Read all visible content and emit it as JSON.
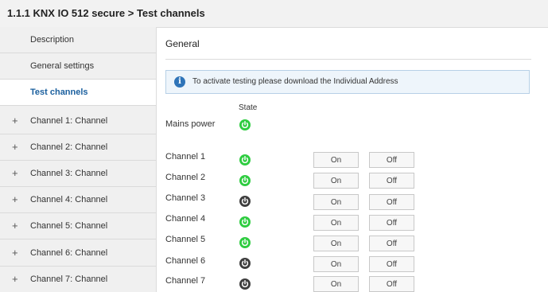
{
  "window": {
    "title": "1.1.1 KNX IO 512 secure > Test channels"
  },
  "sidebar": {
    "items": [
      {
        "label": "Description",
        "expandable": false,
        "active": false
      },
      {
        "label": "General settings",
        "expandable": false,
        "active": false
      },
      {
        "label": "Test channels",
        "expandable": false,
        "active": true
      },
      {
        "label": "Channel 1: Channel",
        "expandable": true,
        "active": false
      },
      {
        "label": "Channel 2: Channel",
        "expandable": true,
        "active": false
      },
      {
        "label": "Channel 3: Channel",
        "expandable": true,
        "active": false
      },
      {
        "label": "Channel 4: Channel",
        "expandable": true,
        "active": false
      },
      {
        "label": "Channel 5: Channel",
        "expandable": true,
        "active": false
      },
      {
        "label": "Channel 6: Channel",
        "expandable": true,
        "active": false
      },
      {
        "label": "Channel 7: Channel",
        "expandable": true,
        "active": false
      }
    ],
    "expand_glyph": "+"
  },
  "main": {
    "section_title": "General",
    "info_icon": "i",
    "info_text": "To activate testing please download the Individual Address",
    "state_header": "State",
    "mains": {
      "label": "Mains power",
      "state": "on"
    },
    "channels": [
      {
        "label": "Channel 1",
        "state": "on",
        "on_label": "On",
        "off_label": "Off"
      },
      {
        "label": "Channel 2",
        "state": "on",
        "on_label": "On",
        "off_label": "Off"
      },
      {
        "label": "Channel 3",
        "state": "off",
        "on_label": "On",
        "off_label": "Off"
      },
      {
        "label": "Channel 4",
        "state": "on",
        "on_label": "On",
        "off_label": "Off"
      },
      {
        "label": "Channel 5",
        "state": "on",
        "on_label": "On",
        "off_label": "Off"
      },
      {
        "label": "Channel 6",
        "state": "off",
        "on_label": "On",
        "off_label": "Off"
      },
      {
        "label": "Channel 7",
        "state": "off",
        "on_label": "On",
        "off_label": "Off"
      }
    ]
  },
  "colors": {
    "state_on": "#2ecc40",
    "state_off": "#3e3e3e",
    "active_nav": "#1a5f9e",
    "info_icon": "#2f74b8"
  }
}
